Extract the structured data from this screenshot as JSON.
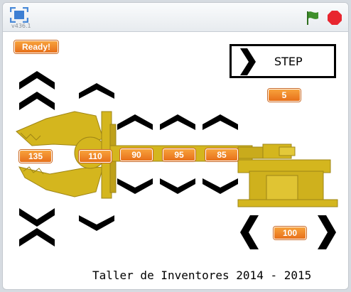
{
  "toolbar": {
    "version": "v436.1",
    "icons": [
      "fullscreen-icon",
      "green-flag-icon",
      "stop-icon"
    ],
    "colors": {
      "flag": "#3f8f2b",
      "stop": "#e8262f"
    }
  },
  "stage": {
    "status_badge": "Ready!",
    "step_button_label": "STEP",
    "step_value": "5",
    "gripper_value": "135",
    "joint_values": [
      "110",
      "90",
      "95",
      "85"
    ],
    "base_value": "100",
    "footer": "Taller de Inventores 2014 - 2015",
    "colors": {
      "arm": "#d4b61e",
      "readout": "#f08a22"
    }
  }
}
